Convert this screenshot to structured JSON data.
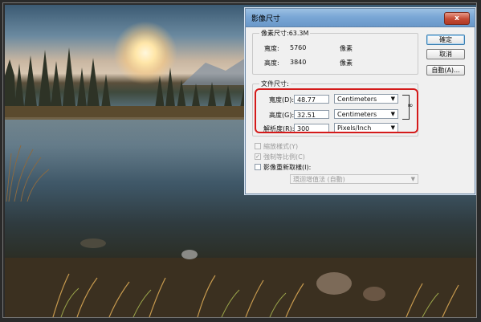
{
  "dialog": {
    "title": "影像尺寸",
    "close_label": "x",
    "pixel_dimensions": {
      "label": "像素尺寸:63.3M",
      "width_label": "寬度:",
      "width_value": "5760",
      "width_unit": "像素",
      "height_label": "高度:",
      "height_value": "3840",
      "height_unit": "像素"
    },
    "document_size": {
      "label": "文件尺寸:",
      "width_label": "寬度(D):",
      "width_value": "48.77",
      "width_unit": "Centimeters",
      "height_label": "高度(G):",
      "height_value": "32.51",
      "height_unit": "Centimeters",
      "resolution_label": "解析度(R):",
      "resolution_value": "300",
      "resolution_unit": "Pixels/Inch"
    },
    "options": {
      "scale_styles": "縮放樣式(Y)",
      "constrain_proportions": "強制等比例(C)",
      "resample": "影像重新取樣(I):",
      "resample_method": "環迴增值法 (自動)"
    },
    "buttons": {
      "ok": "確定",
      "cancel": "取消",
      "auto": "自動(A)..."
    },
    "checkboxes": {
      "scale_styles_checked": true,
      "constrain_checked": true,
      "resample_checked": false
    }
  }
}
